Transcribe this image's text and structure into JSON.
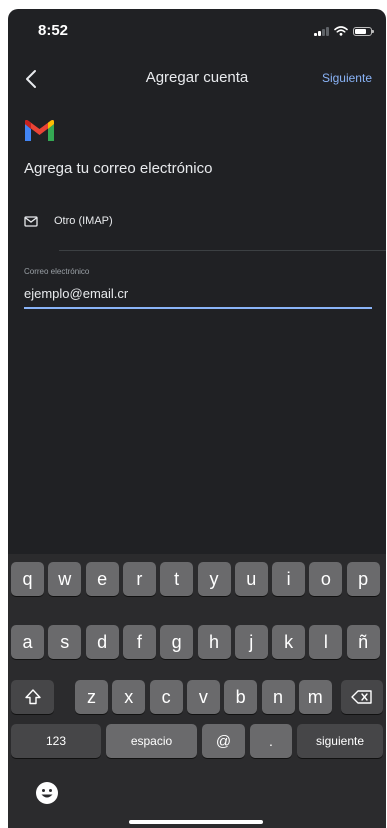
{
  "status_bar": {
    "time": "8:52"
  },
  "app_bar": {
    "title": "Agregar cuenta",
    "next_label": "Siguiente"
  },
  "heading": "Agrega tu correo electrónico",
  "account_type": {
    "label": "Otro (IMAP)",
    "icon": "mail-icon"
  },
  "email_field": {
    "label": "Correo electrónico",
    "value": "ejemplo@email.cr"
  },
  "keyboard": {
    "row1": [
      "q",
      "w",
      "e",
      "r",
      "t",
      "y",
      "u",
      "i",
      "o",
      "p"
    ],
    "row2": [
      "a",
      "s",
      "d",
      "f",
      "g",
      "h",
      "j",
      "k",
      "l",
      "ñ"
    ],
    "row3": [
      "z",
      "x",
      "c",
      "v",
      "b",
      "n",
      "m"
    ],
    "numbers_label": "123",
    "space_label": "espacio",
    "at_label": "@",
    "dot_label": ".",
    "return_label": "siguiente"
  },
  "colors": {
    "background": "#202124",
    "accent": "#8ab4f8",
    "key": "#6a6a6c",
    "function_key": "#464648"
  }
}
